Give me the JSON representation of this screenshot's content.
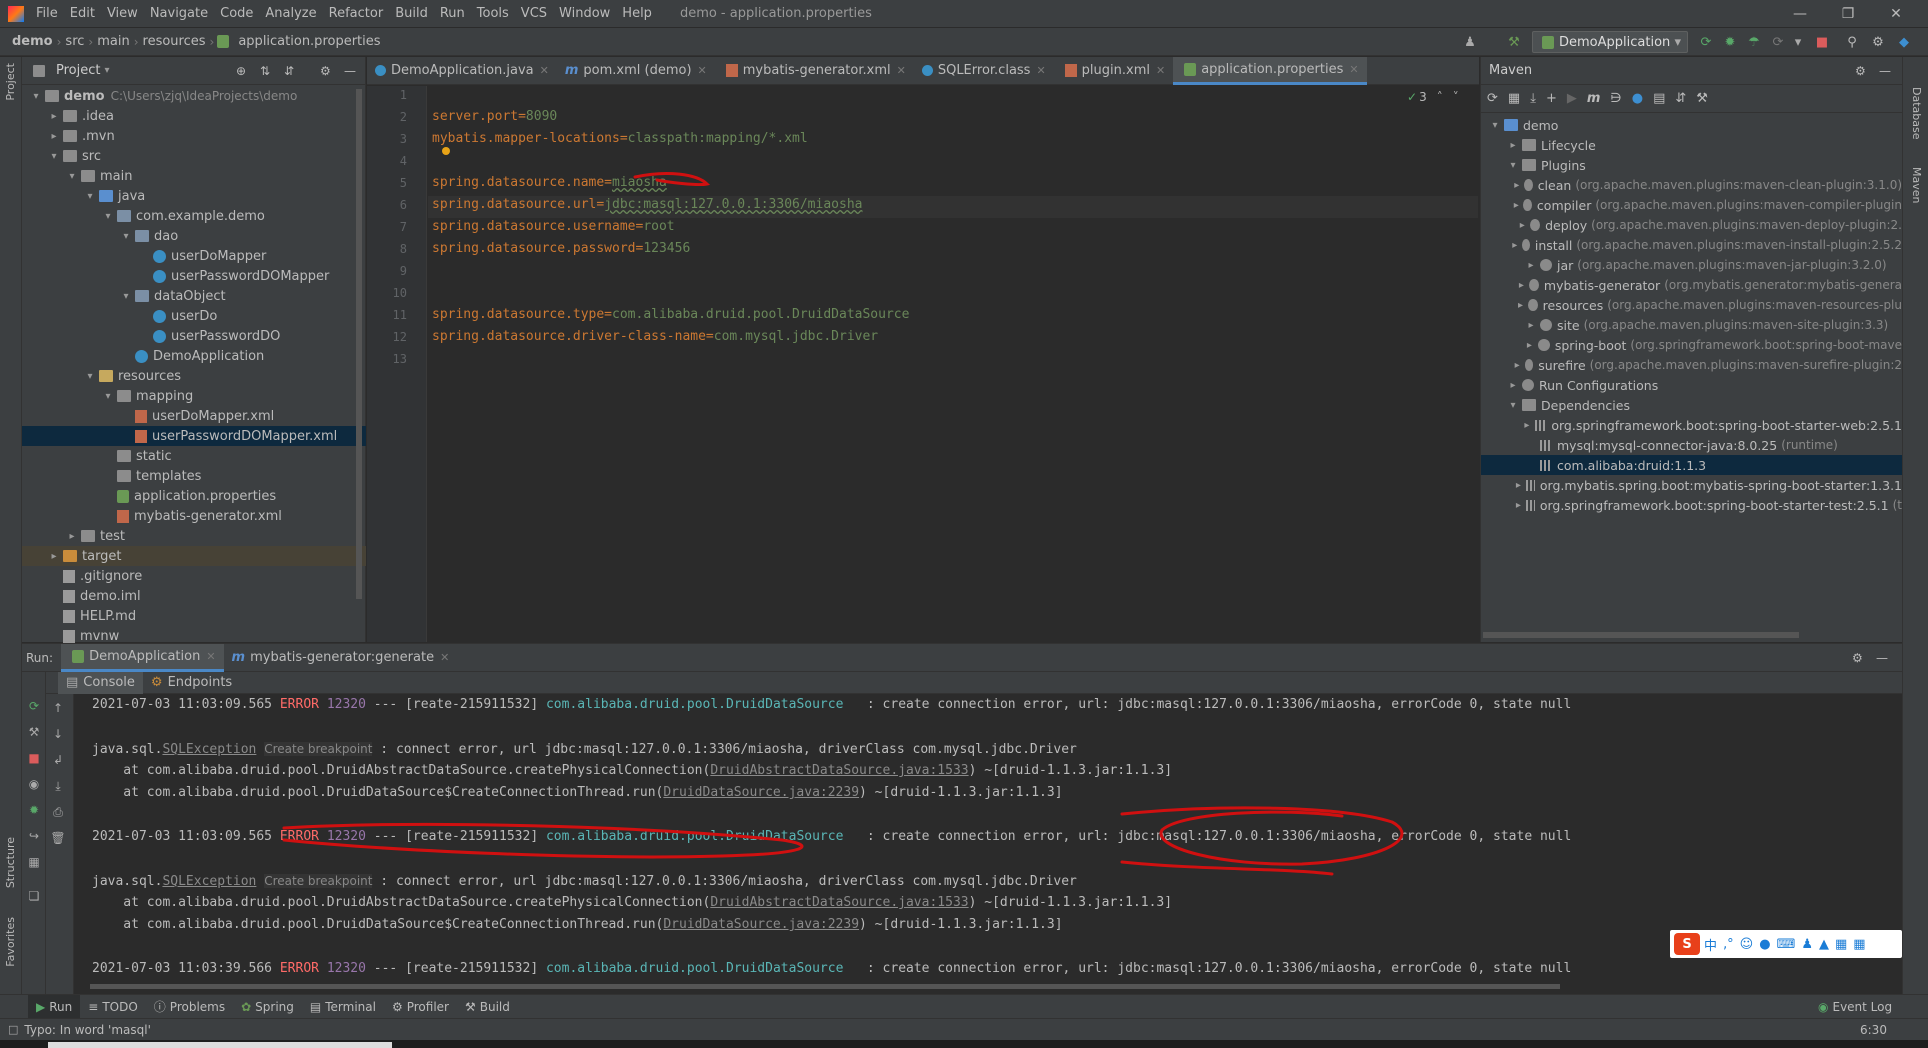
{
  "menubar": {
    "items": [
      "File",
      "Edit",
      "View",
      "Navigate",
      "Code",
      "Analyze",
      "Refactor",
      "Build",
      "Run",
      "Tools",
      "VCS",
      "Window",
      "Help"
    ],
    "title": "demo - application.properties"
  },
  "breadcrumbs": [
    "demo",
    "src",
    "main",
    "resources",
    "application.properties"
  ],
  "run_config": "DemoApplication",
  "project_panel": {
    "title": "Project",
    "root_path": "C:\\Users\\zjq\\IdeaProjects\\demo",
    "tree": [
      {
        "label": "demo",
        "kind": "folder"
      },
      {
        "label": ".idea",
        "kind": "folder"
      },
      {
        "label": ".mvn",
        "kind": "folder"
      },
      {
        "label": "src",
        "kind": "folder"
      },
      {
        "label": "main",
        "kind": "folder"
      },
      {
        "label": "java",
        "kind": "src"
      },
      {
        "label": "com.example.demo",
        "kind": "pkg"
      },
      {
        "label": "dao",
        "kind": "pkg"
      },
      {
        "label": "userDoMapper",
        "kind": "class"
      },
      {
        "label": "userPasswordDOMapper",
        "kind": "class"
      },
      {
        "label": "dataObject",
        "kind": "pkg"
      },
      {
        "label": "userDo",
        "kind": "class"
      },
      {
        "label": "userPasswordDO",
        "kind": "class"
      },
      {
        "label": "DemoApplication",
        "kind": "class"
      },
      {
        "label": "resources",
        "kind": "res"
      },
      {
        "label": "mapping",
        "kind": "folder"
      },
      {
        "label": "userDoMapper.xml",
        "kind": "xml"
      },
      {
        "label": "userPasswordDOMapper.xml",
        "kind": "xml"
      },
      {
        "label": "static",
        "kind": "folder"
      },
      {
        "label": "templates",
        "kind": "folder"
      },
      {
        "label": "application.properties",
        "kind": "prop"
      },
      {
        "label": "mybatis-generator.xml",
        "kind": "xml"
      },
      {
        "label": "test",
        "kind": "folder"
      },
      {
        "label": "target",
        "kind": "tgt"
      },
      {
        "label": ".gitignore",
        "kind": "file"
      },
      {
        "label": "demo.iml",
        "kind": "file"
      },
      {
        "label": "HELP.md",
        "kind": "file"
      },
      {
        "label": "mvnw",
        "kind": "file"
      }
    ]
  },
  "editor_tabs": [
    "DemoApplication.java",
    "pom.xml (demo)",
    "mybatis-generator.xml",
    "SQLError.class",
    "plugin.xml",
    "application.properties"
  ],
  "editor": {
    "inspection_count": "3",
    "line_numbers": [
      "1",
      "2",
      "3",
      "4",
      "5",
      "6",
      "7",
      "8",
      "9",
      "10",
      "11",
      "12",
      "13"
    ],
    "lines": [
      {
        "key": "",
        "val": ""
      },
      {
        "key": "server.port=",
        "val": "8090"
      },
      {
        "key": "mybatis.mapper-locations=",
        "val": "classpath:mapping/*.xml"
      },
      {
        "key": "",
        "val": ""
      },
      {
        "key": "spring.datasource.name=",
        "val": "miaosha"
      },
      {
        "key": "spring.datasource.url=",
        "val": "jdbc:masql:127.0.0.1:3306/miaosha"
      },
      {
        "key": "spring.datasource.username=",
        "val": "root"
      },
      {
        "key": "spring.datasource.password=",
        "val": "123456"
      },
      {
        "key": "",
        "val": ""
      },
      {
        "key": "",
        "val": ""
      },
      {
        "key": "spring.datasource.type=",
        "val": "com.alibaba.druid.pool.DruidDataSource"
      },
      {
        "key": "spring.datasource.driver-class-name=",
        "val": "com.mysql.jdbc.Driver"
      },
      {
        "key": "",
        "val": ""
      }
    ]
  },
  "maven": {
    "title": "Maven",
    "rows": [
      {
        "label": "demo",
        "dim": ""
      },
      {
        "label": "Lifecycle",
        "dim": ""
      },
      {
        "label": "Plugins",
        "dim": ""
      },
      {
        "label": "clean",
        "dim": "(org.apache.maven.plugins:maven-clean-plugin:3.1.0)"
      },
      {
        "label": "compiler",
        "dim": "(org.apache.maven.plugins:maven-compiler-plugin"
      },
      {
        "label": "deploy",
        "dim": "(org.apache.maven.plugins:maven-deploy-plugin:2."
      },
      {
        "label": "install",
        "dim": "(org.apache.maven.plugins:maven-install-plugin:2.5.2"
      },
      {
        "label": "jar",
        "dim": "(org.apache.maven.plugins:maven-jar-plugin:3.2.0)"
      },
      {
        "label": "mybatis-generator",
        "dim": "(org.mybatis.generator:mybatis-genera"
      },
      {
        "label": "resources",
        "dim": "(org.apache.maven.plugins:maven-resources-plu"
      },
      {
        "label": "site",
        "dim": "(org.apache.maven.plugins:maven-site-plugin:3.3)"
      },
      {
        "label": "spring-boot",
        "dim": "(org.springframework.boot:spring-boot-mave"
      },
      {
        "label": "surefire",
        "dim": "(org.apache.maven.plugins:maven-surefire-plugin:2"
      },
      {
        "label": "Run Configurations",
        "dim": ""
      },
      {
        "label": "Dependencies",
        "dim": ""
      },
      {
        "label": "org.springframework.boot:spring-boot-starter-web:2.5.1",
        "dim": ""
      },
      {
        "label": "mysql:mysql-connector-java:8.0.25",
        "dim": "(runtime)"
      },
      {
        "label": "com.alibaba:druid:1.1.3",
        "dim": ""
      },
      {
        "label": "org.mybatis.spring.boot:mybatis-spring-boot-starter:1.3.1",
        "dim": ""
      },
      {
        "label": "org.springframework.boot:spring-boot-starter-test:2.5.1",
        "dim": "(t"
      }
    ]
  },
  "run_panel": {
    "label": "Run:",
    "tabs": [
      "DemoApplication",
      "mybatis-generator:generate"
    ],
    "subtabs": [
      "Console",
      "Endpoints"
    ],
    "log": {
      "line1": {
        "ts": "2021-07-03 11:03:09.565",
        "level": "ERROR",
        "pid": "12320",
        "mid": "--- [reate-215911532]",
        "cls": "com.alibaba.druid.pool.DruidDataSource",
        "msg": "   : create connection error, url: jdbc:masql:127.0.0.1:3306/miaosha, errorCode 0, state null"
      },
      "ex1": {
        "prefix": "java.sql.",
        "exc": "SQLException",
        "bp": "Create breakpoint",
        "msg": ": connect error, url jdbc:masql:127.0.0.1:3306/miaosha, driverClass com.mysql.jdbc.Driver"
      },
      "at1": {
        "pre": "    at com.alibaba.druid.pool.DruidAbstractDataSource.createPhysicalConnection(",
        "link": "DruidAbstractDataSource.java:1533",
        "post": ") ~[druid-1.1.3.jar:1.1.3]"
      },
      "at2": {
        "pre": "    at com.alibaba.druid.pool.DruidDataSource$CreateConnectionThread.run(",
        "link": "DruidDataSource.java:2239",
        "post": ") ~[druid-1.1.3.jar:1.1.3]"
      },
      "line2": {
        "ts": "2021-07-03 11:03:09.565",
        "level": "ERROR",
        "pid": "12320",
        "mid": "--- [reate-215911532]",
        "cls": "com.alibaba.druid.pool.DruidDataSource",
        "msg": "   : create connection error, url: jdbc:masql:127.0.0.1:3306/miaosha, errorCode 0, state null"
      },
      "ex2": {
        "prefix": "java.sql.",
        "exc": "SQLException",
        "bp": "Create breakpoint",
        "msg": ": connect error, url jdbc:masql:127.0.0.1:3306/miaosha, driverClass com.mysql.jdbc.Driver"
      },
      "at3": {
        "pre": "    at com.alibaba.druid.pool.DruidAbstractDataSource.createPhysicalConnection(",
        "link": "DruidAbstractDataSource.java:1533",
        "post": ") ~[druid-1.1.3.jar:1.1.3]"
      },
      "at4": {
        "pre": "    at com.alibaba.druid.pool.DruidDataSource$CreateConnectionThread.run(",
        "link": "DruidDataSource.java:2239",
        "post": ") ~[druid-1.1.3.jar:1.1.3]"
      },
      "line3": {
        "ts": "2021-07-03 11:03:39.566",
        "level": "ERROR",
        "pid": "12320",
        "mid": "--- [reate-215911532]",
        "cls": "com.alibaba.druid.pool.DruidDataSource",
        "msg": "   : create connection error, url: jdbc:masql:127.0.0.1:3306/miaosha, errorCode 0, state null"
      }
    }
  },
  "bottom_tools": [
    "Run",
    "TODO",
    "Problems",
    "Spring",
    "Terminal",
    "Profiler",
    "Build"
  ],
  "event_log": "Event Log",
  "status": {
    "message": "Typo: In word 'masql'",
    "position": "6:30"
  },
  "side_labels": {
    "project": "Project",
    "structure": "Structure",
    "favorites": "Favorites",
    "database": "Database",
    "maven": "Maven"
  },
  "ime": {
    "logo": "S",
    "zh": "中"
  },
  "colors": {
    "accent": "#4a88c7",
    "error": "#ff6b68",
    "annotation": "#d01010"
  }
}
